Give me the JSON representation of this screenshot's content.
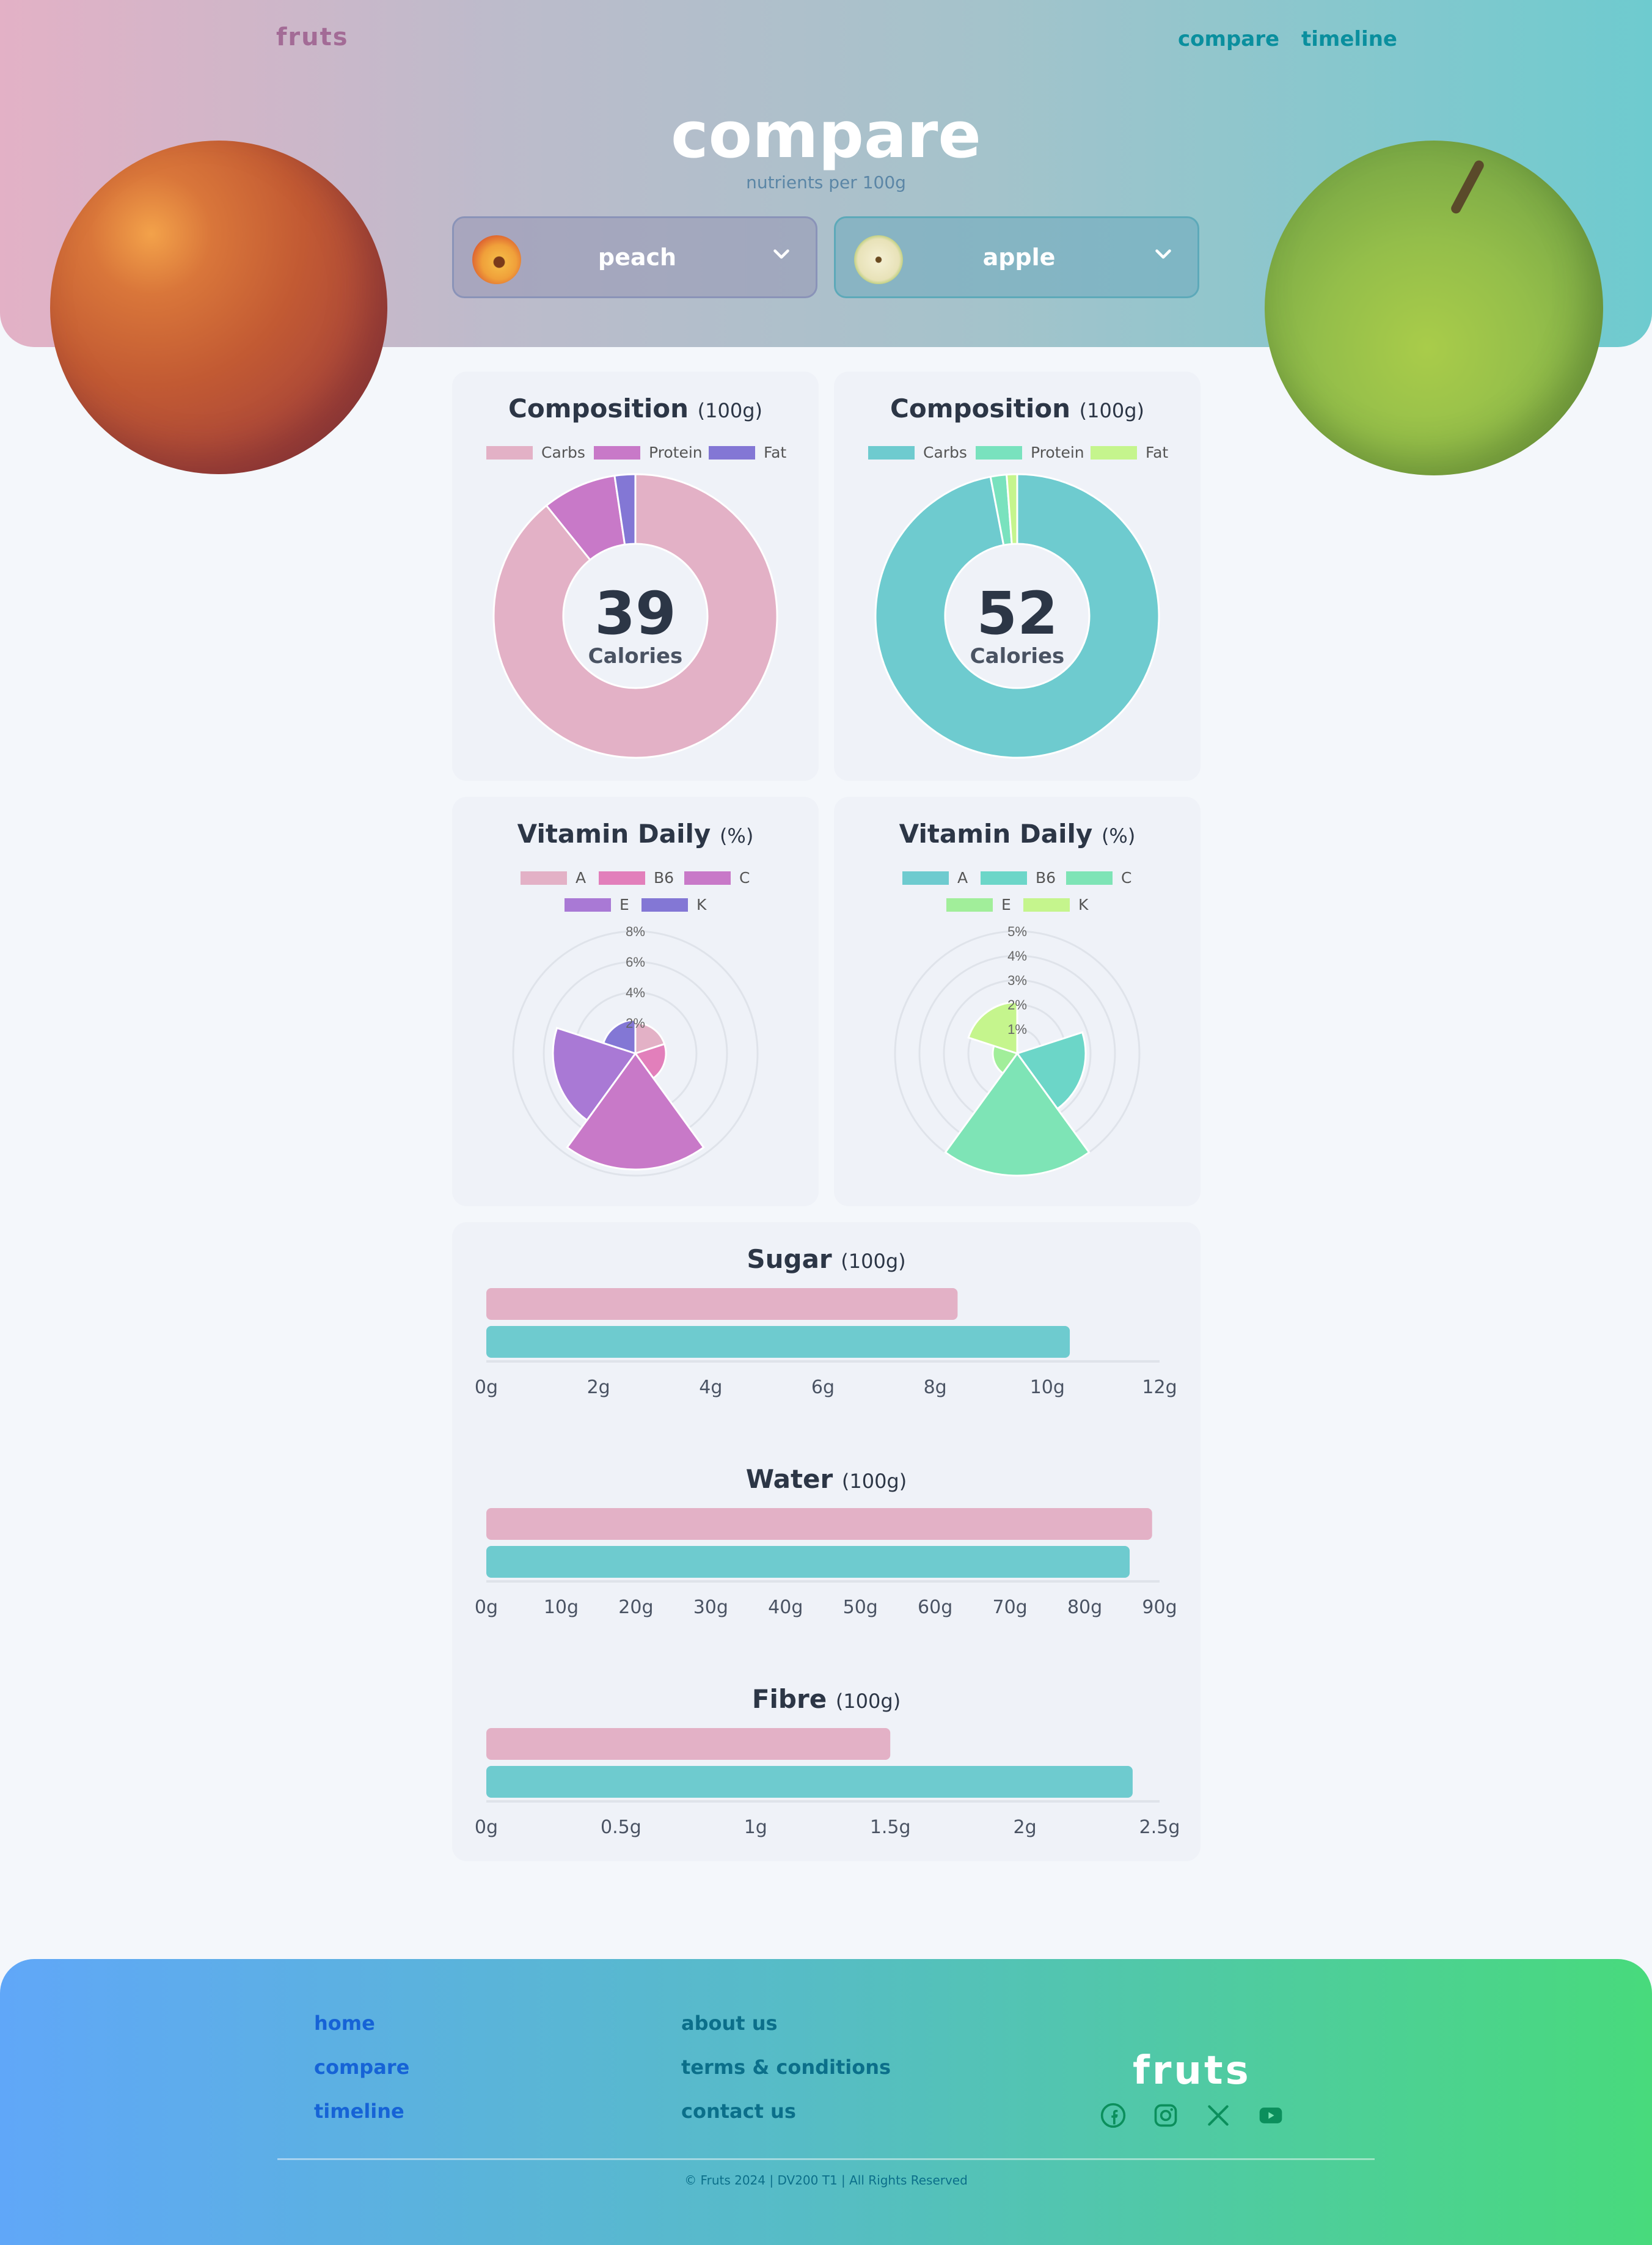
{
  "header": {
    "brand": "fruts",
    "nav": [
      {
        "label": "compare"
      },
      {
        "label": "timeline"
      }
    ],
    "title": "compare",
    "subtitle": "nutrients per 100g"
  },
  "selectors": [
    {
      "label": "peach",
      "icon": "peach-icon"
    },
    {
      "label": "apple",
      "icon": "apple-icon"
    }
  ],
  "colors": {
    "peach_accent": "#e3b1c6",
    "apple_accent": "#6ecbcf"
  },
  "composition": {
    "title": "Composition",
    "unit": "(100g)",
    "legend": [
      "Carbs",
      "Protein",
      "Fat"
    ],
    "peach": {
      "calories": "39",
      "calories_label": "Calories"
    },
    "apple": {
      "calories": "52",
      "calories_label": "Calories"
    }
  },
  "vitamins": {
    "title": "Vitamin Daily",
    "unit": "(%)",
    "legend": [
      "A",
      "B6",
      "C",
      "E",
      "K"
    ]
  },
  "bars": {
    "unit": "(100g)",
    "sugar": {
      "title": "Sugar"
    },
    "water": {
      "title": "Water"
    },
    "fibre": {
      "title": "Fibre"
    }
  },
  "chart_data": [
    {
      "type": "pie",
      "title": "Composition",
      "subtitle": "(100g)",
      "categories": [
        "Carbs",
        "Protein",
        "Fat"
      ],
      "values": [
        9.5,
        0.9,
        0.25
      ],
      "colors": [
        "#e3b1c6",
        "#c879c8",
        "#8377d5"
      ],
      "center_text": "39 Calories"
    },
    {
      "type": "pie",
      "title": "Composition",
      "subtitle": "(100g)",
      "categories": [
        "Carbs",
        "Protein",
        "Fat"
      ],
      "values": [
        13.8,
        0.26,
        0.17
      ],
      "colors": [
        "#6ecbcf",
        "#79e2be",
        "#c5f58d"
      ],
      "center_text": "52 Calories"
    },
    {
      "type": "polar-area",
      "title": "Vitamin Daily",
      "subtitle": "(%)",
      "categories": [
        "A",
        "B6",
        "C",
        "E",
        "K"
      ],
      "values": [
        2,
        2,
        7.6,
        5.4,
        2.2
      ],
      "colors": [
        "#e3b1c6",
        "#e27fbb",
        "#c879c8",
        "#a979d5",
        "#8377d5"
      ],
      "rlim": [
        0,
        8
      ],
      "ticks": [
        "2%",
        "4%",
        "6%",
        "8%"
      ]
    },
    {
      "type": "polar-area",
      "title": "Vitamin Daily",
      "subtitle": "(%)",
      "categories": [
        "A",
        "B6",
        "C",
        "E",
        "K"
      ],
      "values": [
        0.06,
        2.8,
        5.0,
        1.0,
        2.1
      ],
      "colors": [
        "#6ecbcf",
        "#6cd6c8",
        "#7ee4b6",
        "#a1ee9a",
        "#c5f58d"
      ],
      "rlim": [
        0,
        5
      ],
      "ticks": [
        "1%",
        "2%",
        "3%",
        "4%",
        "5%"
      ]
    },
    {
      "type": "bar",
      "orientation": "horizontal",
      "title": "Sugar",
      "subtitle": "(100g)",
      "series": [
        {
          "values": [
            8.4
          ]
        },
        {
          "values": [
            10.4
          ]
        }
      ],
      "colors": [
        "#e3b1c6",
        "#6ecbcf"
      ],
      "xlim": [
        0,
        12
      ],
      "ticks": [
        "0g",
        "2g",
        "4g",
        "6g",
        "8g",
        "10g",
        "12g"
      ]
    },
    {
      "type": "bar",
      "orientation": "horizontal",
      "title": "Water",
      "subtitle": "(100g)",
      "series": [
        {
          "values": [
            89
          ]
        },
        {
          "values": [
            86
          ]
        }
      ],
      "colors": [
        "#e3b1c6",
        "#6ecbcf"
      ],
      "xlim": [
        0,
        90
      ],
      "ticks": [
        "0g",
        "10g",
        "20g",
        "30g",
        "40g",
        "50g",
        "60g",
        "70g",
        "80g",
        "90g"
      ]
    },
    {
      "type": "bar",
      "orientation": "horizontal",
      "title": "Fibre",
      "subtitle": "(100g)",
      "series": [
        {
          "values": [
            1.5
          ]
        },
        {
          "values": [
            2.4
          ]
        }
      ],
      "colors": [
        "#e3b1c6",
        "#6ecbcf"
      ],
      "xlim": [
        0,
        2.5
      ],
      "ticks": [
        "0g",
        "0.5g",
        "1g",
        "1.5g",
        "2g",
        "2.5g"
      ]
    }
  ],
  "footer": {
    "col1": [
      "home",
      "compare",
      "timeline"
    ],
    "col2": [
      "about us",
      "terms & conditions",
      "contact us"
    ],
    "brand": "fruts",
    "social": [
      "facebook-icon",
      "instagram-icon",
      "x-icon",
      "youtube-icon"
    ],
    "copyright": "© Fruts 2024 | DV200 T1 | All Rights Reserved"
  }
}
